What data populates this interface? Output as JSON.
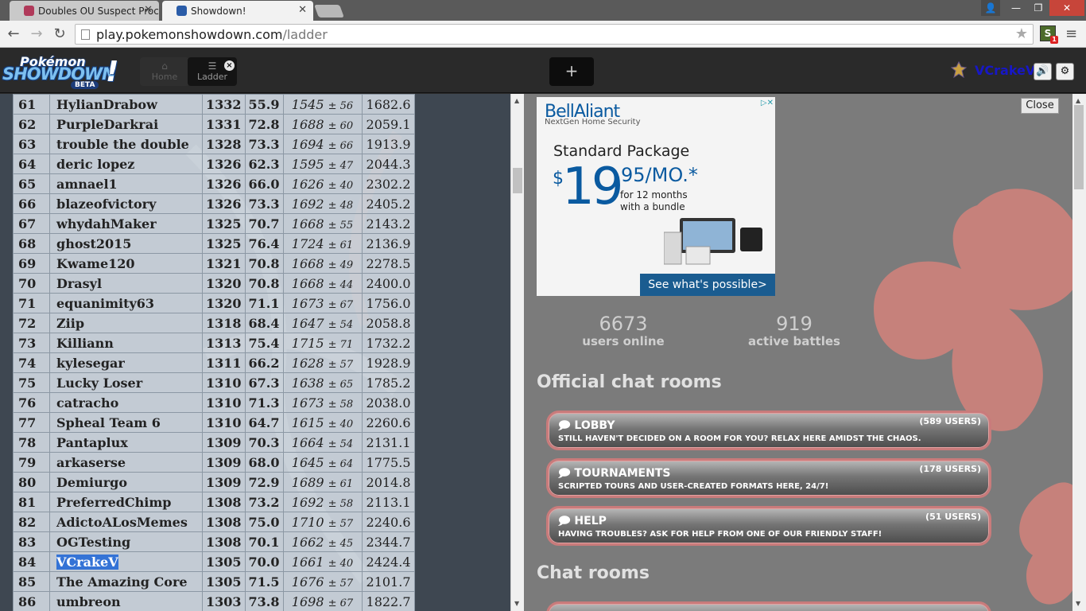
{
  "browser": {
    "tabs": [
      {
        "title": "Doubles OU Suspect Proc"
      },
      {
        "title": "Showdown!"
      }
    ],
    "url_host": "play.pokemonshowdown.com",
    "url_path": "/ladder",
    "extension_badge": "1"
  },
  "header": {
    "logo_line1": "Pokémon",
    "logo_line2": "SHOWDOWN",
    "logo_beta": "BETA",
    "home_tab": "Home",
    "ladder_tab": "Ladder",
    "new_tab": "+",
    "username": "VCrakeV"
  },
  "ladder": {
    "rows": [
      {
        "rank": "61",
        "name": "HylianDrabow",
        "elo": "1332",
        "gxe": "55.9",
        "glicko": "1545",
        "dev": "± 56",
        "cov": "1682.6"
      },
      {
        "rank": "62",
        "name": "PurpleDarkrai",
        "elo": "1331",
        "gxe": "72.8",
        "glicko": "1688",
        "dev": "± 60",
        "cov": "2059.1"
      },
      {
        "rank": "63",
        "name": "trouble the double",
        "elo": "1328",
        "gxe": "73.3",
        "glicko": "1694",
        "dev": "± 66",
        "cov": "1913.9"
      },
      {
        "rank": "64",
        "name": "deric lopez",
        "elo": "1326",
        "gxe": "62.3",
        "glicko": "1595",
        "dev": "± 47",
        "cov": "2044.3"
      },
      {
        "rank": "65",
        "name": "amnael1",
        "elo": "1326",
        "gxe": "66.0",
        "glicko": "1626",
        "dev": "± 40",
        "cov": "2302.2"
      },
      {
        "rank": "66",
        "name": "blazeofvictory",
        "elo": "1326",
        "gxe": "73.3",
        "glicko": "1692",
        "dev": "± 48",
        "cov": "2405.2"
      },
      {
        "rank": "67",
        "name": "whydahMaker",
        "elo": "1325",
        "gxe": "70.7",
        "glicko": "1668",
        "dev": "± 55",
        "cov": "2143.2"
      },
      {
        "rank": "68",
        "name": "ghost2015",
        "elo": "1325",
        "gxe": "76.4",
        "glicko": "1724",
        "dev": "± 61",
        "cov": "2136.9"
      },
      {
        "rank": "69",
        "name": "Kwame120",
        "elo": "1321",
        "gxe": "70.8",
        "glicko": "1668",
        "dev": "± 49",
        "cov": "2278.5"
      },
      {
        "rank": "70",
        "name": "Drasyl",
        "elo": "1320",
        "gxe": "70.8",
        "glicko": "1668",
        "dev": "± 44",
        "cov": "2400.0"
      },
      {
        "rank": "71",
        "name": "equanimity63",
        "elo": "1320",
        "gxe": "71.1",
        "glicko": "1673",
        "dev": "± 67",
        "cov": "1756.0"
      },
      {
        "rank": "72",
        "name": "Ziip",
        "elo": "1318",
        "gxe": "68.4",
        "glicko": "1647",
        "dev": "± 54",
        "cov": "2058.8"
      },
      {
        "rank": "73",
        "name": "Killiann",
        "elo": "1313",
        "gxe": "75.4",
        "glicko": "1715",
        "dev": "± 71",
        "cov": "1732.2"
      },
      {
        "rank": "74",
        "name": "kylesegar",
        "elo": "1311",
        "gxe": "66.2",
        "glicko": "1628",
        "dev": "± 57",
        "cov": "1928.9"
      },
      {
        "rank": "75",
        "name": "Lucky Loser",
        "elo": "1310",
        "gxe": "67.3",
        "glicko": "1638",
        "dev": "± 65",
        "cov": "1785.2"
      },
      {
        "rank": "76",
        "name": "catracho",
        "elo": "1310",
        "gxe": "71.3",
        "glicko": "1673",
        "dev": "± 58",
        "cov": "2038.0"
      },
      {
        "rank": "77",
        "name": "Spheal Team 6",
        "elo": "1310",
        "gxe": "64.7",
        "glicko": "1615",
        "dev": "± 40",
        "cov": "2260.6"
      },
      {
        "rank": "78",
        "name": "Pantaplux",
        "elo": "1309",
        "gxe": "70.3",
        "glicko": "1664",
        "dev": "± 54",
        "cov": "2131.1"
      },
      {
        "rank": "79",
        "name": "arkaserse",
        "elo": "1309",
        "gxe": "68.0",
        "glicko": "1645",
        "dev": "± 64",
        "cov": "1775.5"
      },
      {
        "rank": "80",
        "name": "Demiurgo",
        "elo": "1309",
        "gxe": "72.9",
        "glicko": "1689",
        "dev": "± 61",
        "cov": "2014.8"
      },
      {
        "rank": "81",
        "name": "PreferredChimp",
        "elo": "1308",
        "gxe": "73.2",
        "glicko": "1692",
        "dev": "± 58",
        "cov": "2113.1"
      },
      {
        "rank": "82",
        "name": "AdictoALosMemes",
        "elo": "1308",
        "gxe": "75.0",
        "glicko": "1710",
        "dev": "± 57",
        "cov": "2240.6"
      },
      {
        "rank": "83",
        "name": "OGTesting",
        "elo": "1308",
        "gxe": "70.1",
        "glicko": "1662",
        "dev": "± 45",
        "cov": "2344.7"
      },
      {
        "rank": "84",
        "name": "VCrakeV",
        "elo": "1305",
        "gxe": "70.0",
        "glicko": "1661",
        "dev": "± 40",
        "cov": "2424.4",
        "highlight": true
      },
      {
        "rank": "85",
        "name": "The Amazing Core",
        "elo": "1305",
        "gxe": "71.5",
        "glicko": "1676",
        "dev": "± 57",
        "cov": "2101.7"
      },
      {
        "rank": "86",
        "name": "umbreon",
        "elo": "1303",
        "gxe": "73.8",
        "glicko": "1698",
        "dev": "± 67",
        "cov": "1822.7"
      }
    ]
  },
  "ad": {
    "brand": "BellAliant",
    "brand_sub": "NextGen Home Security",
    "package": "Standard Package",
    "dollar": "$",
    "price": "19",
    "cents": "95/MO.*",
    "terms": "for 12 months with a bundle",
    "cta": "See what's possible>"
  },
  "main": {
    "close_label": "Close",
    "users_online_count": "6673",
    "users_online_label": "users online",
    "active_battles_count": "919",
    "active_battles_label": "active battles",
    "official_heading": "Official chat rooms",
    "chat_heading": "Chat rooms",
    "rooms": [
      {
        "name": "LOBBY",
        "users": "(589 USERS)",
        "desc": "STILL HAVEN'T DECIDED ON A ROOM FOR YOU? RELAX HERE AMIDST THE CHAOS."
      },
      {
        "name": "TOURNAMENTS",
        "users": "(178 USERS)",
        "desc": "SCRIPTED TOURS AND USER-CREATED FORMATS HERE, 24/7!"
      },
      {
        "name": "HELP",
        "users": "(51 USERS)",
        "desc": "HAVING TROUBLES? ASK FOR HELP FROM ONE OF OUR FRIENDLY STAFF!"
      }
    ]
  },
  "colors": {
    "username": "#1717c7",
    "room_border": "#c97b7b",
    "selection": "#3473d6",
    "ad_blue": "#0a5aa0"
  }
}
